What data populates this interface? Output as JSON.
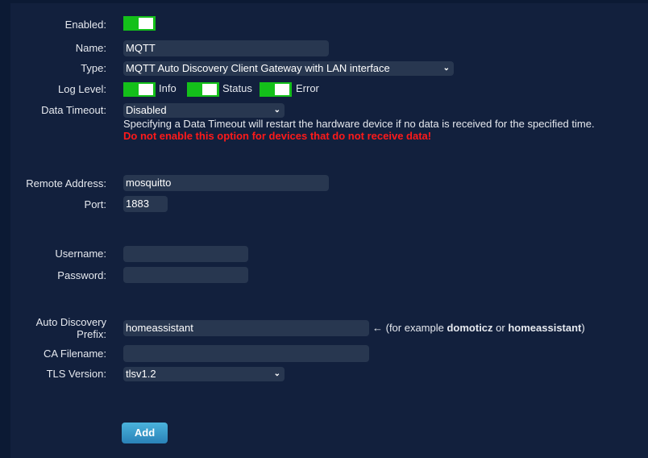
{
  "enabled": {
    "label": "Enabled:",
    "value": true
  },
  "name": {
    "label": "Name:",
    "value": "MQTT"
  },
  "type": {
    "label": "Type:",
    "value": "MQTT Auto Discovery Client Gateway with LAN interface"
  },
  "log_level": {
    "label": "Log Level:",
    "info": "Info",
    "status": "Status",
    "error": "Error"
  },
  "data_timeout": {
    "label": "Data Timeout:",
    "value": "Disabled",
    "help": "Specifying a Data Timeout will restart the hardware device if no data is received for the specified time.",
    "warning": "Do not enable this option for devices that do not receive data!"
  },
  "remote_address": {
    "label": "Remote Address:",
    "value": "mosquitto"
  },
  "port": {
    "label": "Port:",
    "value": "1883"
  },
  "username": {
    "label": "Username:",
    "value": ""
  },
  "password": {
    "label": "Password:",
    "value": ""
  },
  "prefix": {
    "label_1": "Auto Discovery",
    "label_2": "Prefix:",
    "value": "homeassistant",
    "hint_pre": "← (for example ",
    "hint_a": "domoticz",
    "hint_or": " or ",
    "hint_b": "homeassistant",
    "hint_post": ")"
  },
  "ca_filename": {
    "label": "CA Filename:",
    "value": ""
  },
  "tls_version": {
    "label": "TLS Version:",
    "value": "tlsv1.2"
  },
  "add_label": "Add",
  "colors": {
    "toggle_on": "#14c01a",
    "warning": "#ff1a1a",
    "panel": "#12203d"
  }
}
